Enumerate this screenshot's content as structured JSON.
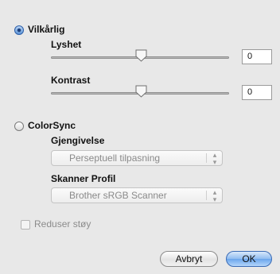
{
  "brightness_contrast": {
    "arbitrary_label": "Vilkårlig",
    "arbitrary_selected": true,
    "brightness_label": "Lyshet",
    "brightness_value": "0",
    "brightness_slider_fraction": 0.5,
    "contrast_label": "Kontrast",
    "contrast_value": "0",
    "contrast_slider_fraction": 0.5
  },
  "colorsync": {
    "label": "ColorSync",
    "selected": false,
    "rendering_label": "Gjengivelse",
    "rendering_value": "Perseptuell tilpasning",
    "scanner_profile_label": "Skanner Profil",
    "scanner_profile_value": "Brother sRGB Scanner"
  },
  "noise": {
    "label": "Reduser støy",
    "checked": false,
    "enabled": false
  },
  "buttons": {
    "cancel_label": "Avbryt",
    "ok_label": "OK"
  }
}
